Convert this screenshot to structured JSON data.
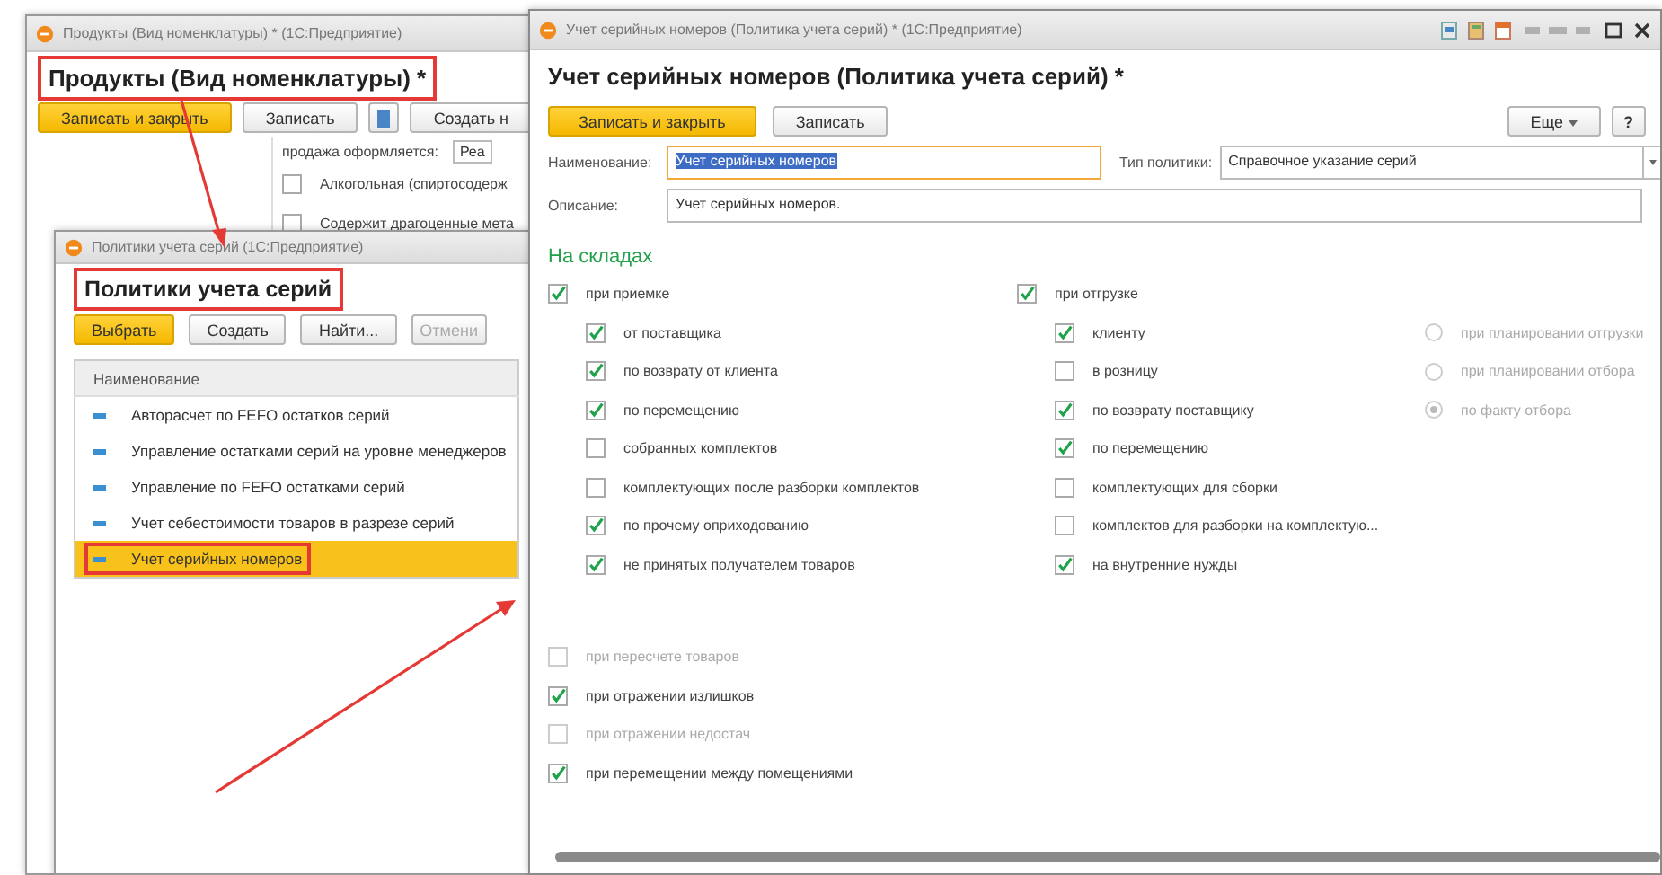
{
  "product_window": {
    "title": "Продукты (Вид номенклатуры) * (1С:Предприятие)",
    "heading": {
      "text": "Продукты (Вид номенклатуры) *",
      "highlighted": true
    },
    "buttons": [
      {
        "label": "Записать и закрыть",
        "kind": "primary"
      },
      {
        "label": "Записать",
        "kind": "normal"
      },
      {
        "kind": "icon"
      },
      {
        "label": "Создать н",
        "kind": "normal"
      }
    ],
    "field": {
      "label": "продажа оформляется:",
      "value": "Реа"
    },
    "options": [
      {
        "label": "Алкогольная (спиртосодерж",
        "checked": false
      },
      {
        "label": "Содержит драгоценные мета",
        "checked": false
      }
    ]
  },
  "list_window": {
    "title": "Политики учета серий (1С:Предприятие)",
    "heading": {
      "text": "Политики учета серий",
      "highlighted": true
    },
    "buttons": [
      {
        "label": "Выбрать",
        "kind": "primary"
      },
      {
        "label": "Создать",
        "kind": "normal"
      },
      {
        "label": "Найти...",
        "kind": "normal"
      },
      {
        "label": "Отмени",
        "kind": "disabled"
      }
    ],
    "column": "Наименование",
    "rows": [
      {
        "name": "Авторасчет по FEFO остатков серий",
        "selected": false,
        "highlighted": false
      },
      {
        "name": "Управление остатками серий на уровне менеджеров",
        "selected": false,
        "highlighted": false
      },
      {
        "name": "Управление по FEFO остатками серий",
        "selected": false,
        "highlighted": false
      },
      {
        "name": "Учет себестоимости товаров в разрезе серий",
        "selected": false,
        "highlighted": false
      },
      {
        "name": "Учет серийных номеров",
        "selected": true,
        "highlighted": true
      }
    ]
  },
  "form_window": {
    "title": "Учет серийных номеров (Политика учета серий) * (1С:Предприятие)",
    "heading": "Учет серийных номеров (Политика учета серий) *",
    "buttons": [
      {
        "label": "Записать и закрыть",
        "kind": "primary"
      },
      {
        "label": "Записать",
        "kind": "normal"
      }
    ],
    "more_button": "Еще",
    "help_button": "?",
    "name_field": {
      "label": "Наименование:",
      "value": "Учет серийных номеров"
    },
    "policy_type_field": {
      "label": "Тип политики:",
      "value": "Справочное указание серий"
    },
    "description_field": {
      "label": "Описание:",
      "value": "Учет серийных номеров."
    },
    "section_title": "На складах",
    "groups": [
      {
        "label": "при приемке",
        "checked": true,
        "children": [
          {
            "label": "от поставщика",
            "checked": true
          },
          {
            "label": "по возврату от клиента",
            "checked": true
          },
          {
            "label": "по перемещению",
            "checked": true
          },
          {
            "label": "собранных комплектов",
            "checked": false
          },
          {
            "label": "комплектующих после разборки комплектов",
            "checked": false
          },
          {
            "label": "по прочему оприходованию",
            "checked": true
          },
          {
            "label": "не принятых получателем товаров",
            "checked": true
          }
        ]
      },
      {
        "label": "при отгрузке",
        "checked": true,
        "children": [
          {
            "label": "клиенту",
            "checked": true
          },
          {
            "label": "в розницу",
            "checked": false
          },
          {
            "label": "по возврату поставщику",
            "checked": true
          },
          {
            "label": "по перемещению",
            "checked": true
          },
          {
            "label": "комплектующих для сборки",
            "checked": false
          },
          {
            "label": "комплектов для разборки на комплектую...",
            "checked": false
          },
          {
            "label": "на внутренние нужды",
            "checked": true
          }
        ]
      }
    ],
    "shipment_timing": [
      {
        "label": "при планировании отгрузки",
        "selected": false
      },
      {
        "label": "при планировании отбора",
        "selected": false
      },
      {
        "label": "по факту отбора",
        "selected": true
      }
    ],
    "extra_options": [
      {
        "label": "при пересчете товаров",
        "checked": false,
        "disabled": true
      },
      {
        "label": "при отражении излишков",
        "checked": true,
        "disabled": false
      },
      {
        "label": "при отражении недостач",
        "checked": false,
        "disabled": true
      },
      {
        "label": "при перемещении между помещениями",
        "checked": true,
        "disabled": false
      }
    ]
  }
}
